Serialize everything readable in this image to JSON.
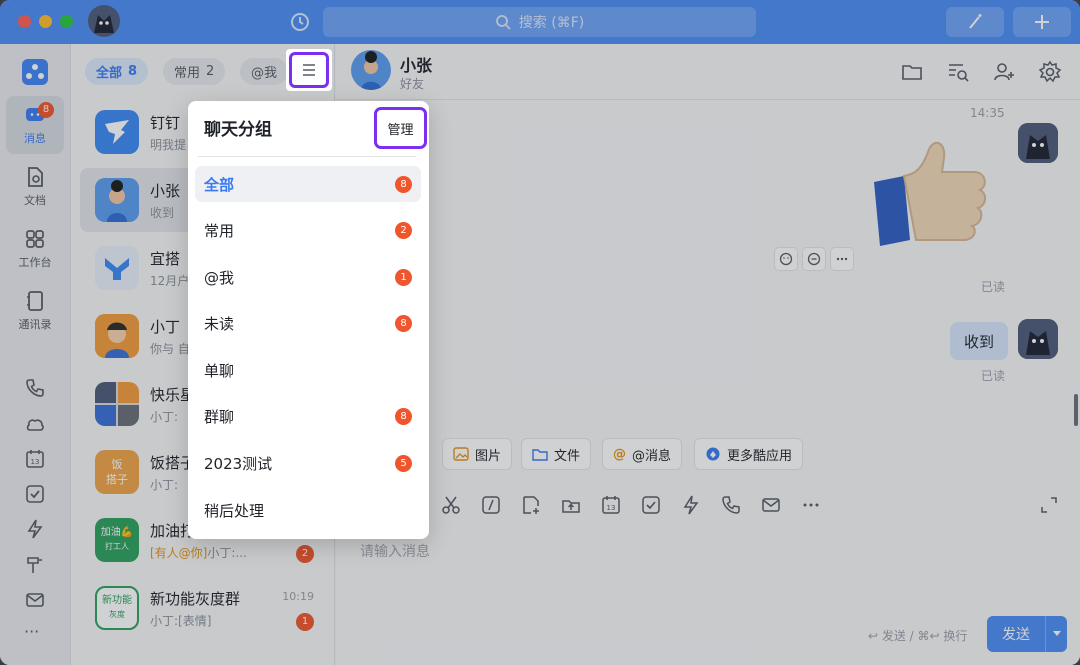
{
  "titlebar": {
    "search_placeholder": "搜索 (⌘F)",
    "accent_color": "#4c8ef7",
    "buttons": [
      "magic-wand-icon",
      "plus-icon"
    ]
  },
  "rail": {
    "items": [
      {
        "label": "消息",
        "icon": "message-icon",
        "badge": "8",
        "active": true
      },
      {
        "label": "文档",
        "icon": "document-icon"
      },
      {
        "label": "工作台",
        "icon": "grid-icon"
      },
      {
        "label": "通讯录",
        "icon": "contacts-icon"
      }
    ],
    "more": "···"
  },
  "filters": {
    "all_label": "全部",
    "all_count": "8",
    "common_label": "常用",
    "common_count": "2",
    "at_label": "@我"
  },
  "conversations": [
    {
      "name": "钉钉",
      "sub": "明我提"
    },
    {
      "name": "小张",
      "sub": "收到"
    },
    {
      "name": "宜搭",
      "sub": "12月户"
    },
    {
      "name": "小丁",
      "sub": "你与 自"
    },
    {
      "name": "快乐星",
      "sub": "小丁:"
    },
    {
      "name": "饭搭子",
      "sub": "小丁:",
      "avatar_text_1": "饭",
      "avatar_text_2": "搭子"
    },
    {
      "name": "加油打",
      "tag": "[有人@你]",
      "sub": "小丁:...",
      "badge": "2",
      "avatar_text_1": "加油💪",
      "avatar_text_2": "打工人"
    },
    {
      "name": "新功能灰度群",
      "sub": "小丁:[表情]",
      "time": "10:19",
      "badge": "1",
      "avatar_text_1": "新功能",
      "avatar_text_2": "灰度"
    }
  ],
  "chat": {
    "name": "小张",
    "relation": "好友",
    "time": "14:35",
    "read_label": "已读",
    "reply_text": "收到",
    "apps": [
      "图片",
      "文件",
      "@消息",
      "更多酷应用"
    ],
    "input_placeholder": "请输入消息",
    "send_hint": "↩ 发送 / ⌘↩ 换行",
    "send_label": "发送"
  },
  "popover": {
    "title": "聊天分组",
    "manage_label": "管理",
    "items": [
      {
        "label": "全部",
        "badge": "8",
        "active": true
      },
      {
        "label": "常用",
        "badge": "2"
      },
      {
        "label": "@我",
        "badge": "1"
      },
      {
        "label": "未读",
        "badge": "8"
      },
      {
        "label": "单聊"
      },
      {
        "label": "群聊",
        "badge": "8"
      },
      {
        "label": "2023测试",
        "badge": "5"
      },
      {
        "label": "稍后处理"
      }
    ]
  }
}
